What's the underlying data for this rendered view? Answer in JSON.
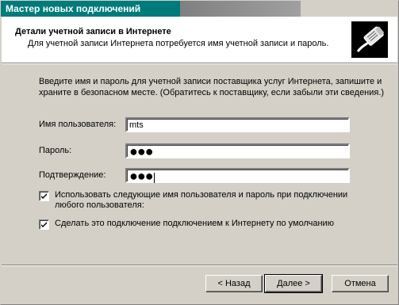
{
  "window": {
    "title": "Мастер новых подключений"
  },
  "header": {
    "title": "Детали учетной записи в Интернете",
    "subtitle": "Для учетной записи Интернета потребуется имя учетной записи и пароль.",
    "icon": "network-cable-icon"
  },
  "instructions": "Введите имя и пароль для учетной записи поставщика услуг Интернета, запишите и храните в безопасном месте. (Обратитесь к поставщику, если забыли эти сведения.)",
  "form": {
    "username_label": "Имя пользователя:",
    "username_value": "mts",
    "password_label": "Пароль:",
    "password_value": "●●●",
    "confirm_label": "Подтверждение:",
    "confirm_value": "●●●"
  },
  "options": {
    "use_for_all_label": "Использовать следующие имя пользователя и пароль при подключении любого пользователя:",
    "use_for_all_checked": true,
    "default_connection_label": "Сделать это подключение подключением к Интернету по умолчанию",
    "default_connection_checked": true
  },
  "buttons": {
    "back": "< Назад",
    "next": "Далее >",
    "cancel": "Отмена"
  }
}
